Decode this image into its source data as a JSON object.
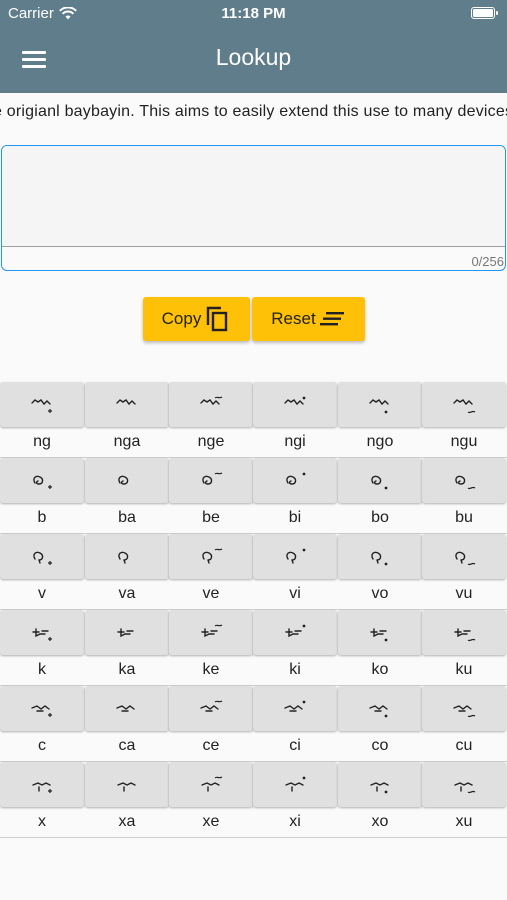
{
  "status_bar": {
    "carrier": "Carrier",
    "time": "11:18 PM"
  },
  "app_bar": {
    "title": "Lookup"
  },
  "marquee_text": "e origianl baybayin. This aims to easily extend this use to many devices",
  "input": {
    "value": "",
    "placeholder": "",
    "counter": "0/256"
  },
  "buttons": {
    "copy_label": "Copy",
    "reset_label": "Reset"
  },
  "colors": {
    "app_bar": "#607d8b",
    "accent_button": "#ffc107",
    "focus_border": "#2196f3",
    "key_bg": "#e0e0e0"
  },
  "keyboard": [
    {
      "labels": [
        "ng",
        "nga",
        "nge",
        "ngi",
        "ngo",
        "ngu"
      ]
    },
    {
      "labels": [
        "b",
        "ba",
        "be",
        "bi",
        "bo",
        "bu"
      ]
    },
    {
      "labels": [
        "v",
        "va",
        "ve",
        "vi",
        "vo",
        "vu"
      ]
    },
    {
      "labels": [
        "k",
        "ka",
        "ke",
        "ki",
        "ko",
        "ku"
      ]
    },
    {
      "labels": [
        "c",
        "ca",
        "ce",
        "ci",
        "co",
        "cu"
      ]
    },
    {
      "labels": [
        "x",
        "xa",
        "xe",
        "xi",
        "xo",
        "xu"
      ]
    }
  ]
}
